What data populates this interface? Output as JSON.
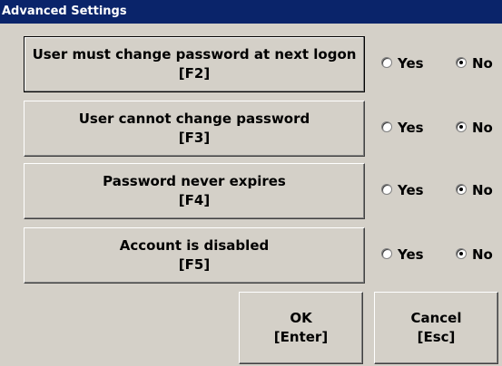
{
  "window": {
    "title": "Advanced Settings"
  },
  "options": [
    {
      "label": "User must change password at next logon",
      "key": "[F2]",
      "yes_label": "Yes",
      "no_label": "No",
      "selected": "No"
    },
    {
      "label": "User cannot change password",
      "key": "[F3]",
      "yes_label": "Yes",
      "no_label": "No",
      "selected": "No"
    },
    {
      "label": "Password never expires",
      "key": "[F4]",
      "yes_label": "Yes",
      "no_label": "No",
      "selected": "No"
    },
    {
      "label": "Account is disabled",
      "key": "[F5]",
      "yes_label": "Yes",
      "no_label": "No",
      "selected": "No"
    }
  ],
  "buttons": {
    "ok": {
      "label": "OK",
      "key": "[Enter]"
    },
    "cancel": {
      "label": "Cancel",
      "key": "[Esc]"
    }
  },
  "colors": {
    "title_bar": "#0a246a",
    "face": "#d4d0c8"
  }
}
